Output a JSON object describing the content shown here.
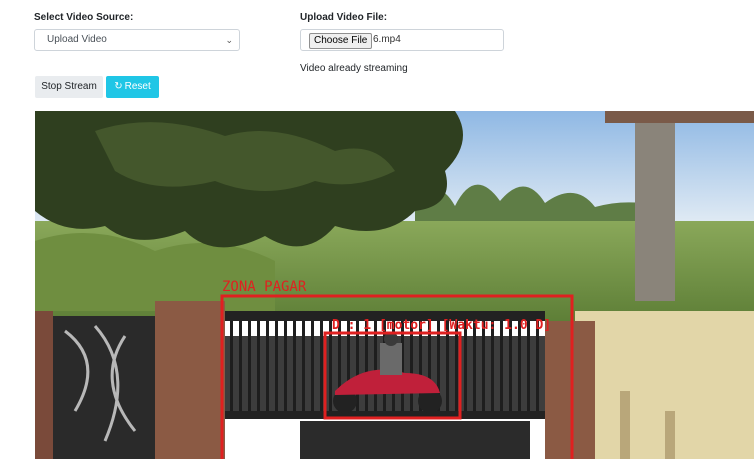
{
  "source": {
    "label": "Select Video Source:",
    "selected": "Upload Video"
  },
  "upload": {
    "label": "Upload Video File:",
    "button": "Choose File",
    "file_name": "6.mp4",
    "status": "Video already streaming"
  },
  "controls": {
    "stop_label": "Stop Stream",
    "reset_label": "Reset",
    "reset_icon": "refresh-icon"
  },
  "video": {
    "zone_label": "ZONA PAGAR",
    "detection_label": "D : 1 [motor] [Waktu: 1.0 D]",
    "colors": {
      "zone": "#e02020",
      "detection": "#e02020"
    }
  }
}
